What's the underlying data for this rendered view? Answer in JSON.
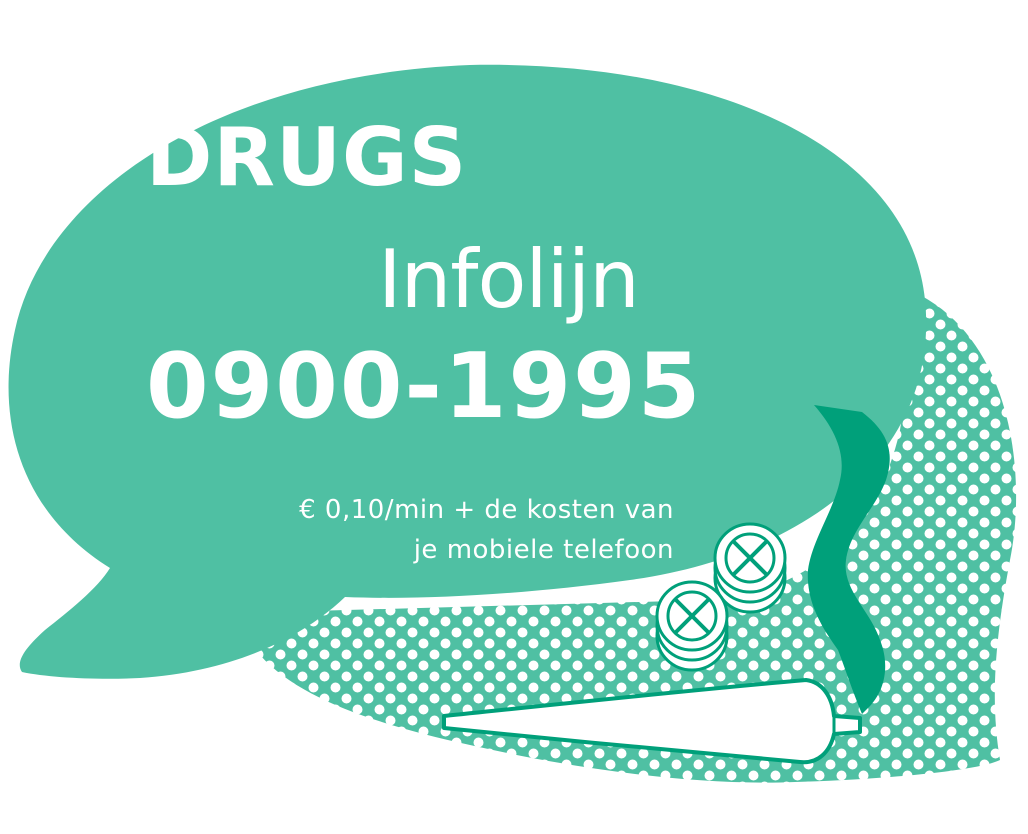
{
  "headline": {
    "drugs": "DRUGS",
    "infolijn": "Infolijn",
    "phone": "0900-1995"
  },
  "cost_note": {
    "line1": "€ 0,10/min + de kosten van",
    "line2": "je mobiele telefoon"
  },
  "colors": {
    "bubble": "#4fc0a3",
    "accent_dark": "#00a07a",
    "dots": "#ffffff",
    "text": "#ffffff"
  },
  "icons": {
    "main_bubble": "speech-bubble",
    "pattern_bubble": "dotted-speech-bubble",
    "pills": "ecstasy-pills-icon",
    "joint": "joint-icon",
    "smoke": "smoke-icon"
  }
}
